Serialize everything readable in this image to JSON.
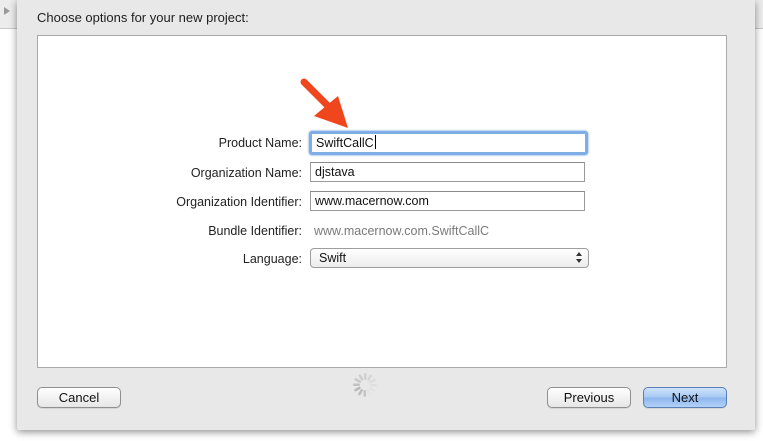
{
  "dialog": {
    "title": "Choose options for your new project:"
  },
  "form": {
    "product_name": {
      "label": "Product Name:",
      "value": "SwiftCallC"
    },
    "organization_name": {
      "label": "Organization Name:",
      "value": "djstava"
    },
    "organization_identifier": {
      "label": "Organization Identifier:",
      "value": "www.macernow.com"
    },
    "bundle_identifier": {
      "label": "Bundle Identifier:",
      "value": "www.macernow.com.SwiftCallC"
    },
    "language": {
      "label": "Language:",
      "selected": "Swift"
    }
  },
  "buttons": {
    "cancel": "Cancel",
    "previous": "Previous",
    "next": "Next"
  },
  "colors": {
    "focus_ring": "#7faee6",
    "default_button": "#a6c8f3",
    "annotation_arrow": "#f0461e"
  },
  "icons": {
    "arrow": "red-annotation-arrow-icon",
    "spinner": "progress-spinner-icon",
    "popup": "popup-arrows-icon"
  }
}
